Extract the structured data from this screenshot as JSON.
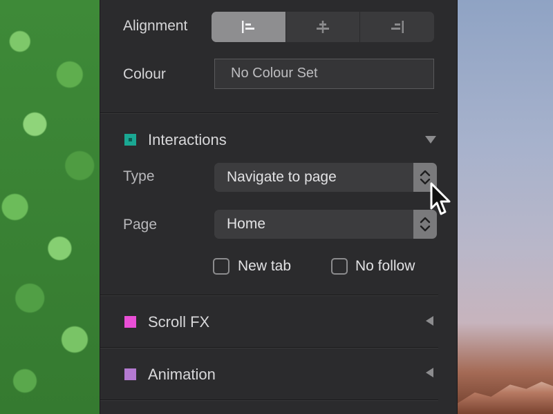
{
  "alignment": {
    "label": "Alignment",
    "options": [
      "align-left-icon",
      "align-center-icon",
      "align-right-icon"
    ],
    "selected_index": 0
  },
  "colour": {
    "label": "Colour",
    "value": "No Colour Set"
  },
  "interactions": {
    "title": "Interactions",
    "color": "#1aa893",
    "expanded": true,
    "type": {
      "label": "Type",
      "value": "Navigate to page"
    },
    "page": {
      "label": "Page",
      "value": "Home"
    },
    "new_tab": {
      "label": "New tab",
      "checked": false
    },
    "no_follow": {
      "label": "No follow",
      "checked": false
    }
  },
  "scroll_fx": {
    "title": "Scroll FX",
    "color": "#e94fd6",
    "expanded": false
  },
  "animation": {
    "title": "Animation",
    "color": "#b47ad1",
    "expanded": false
  }
}
